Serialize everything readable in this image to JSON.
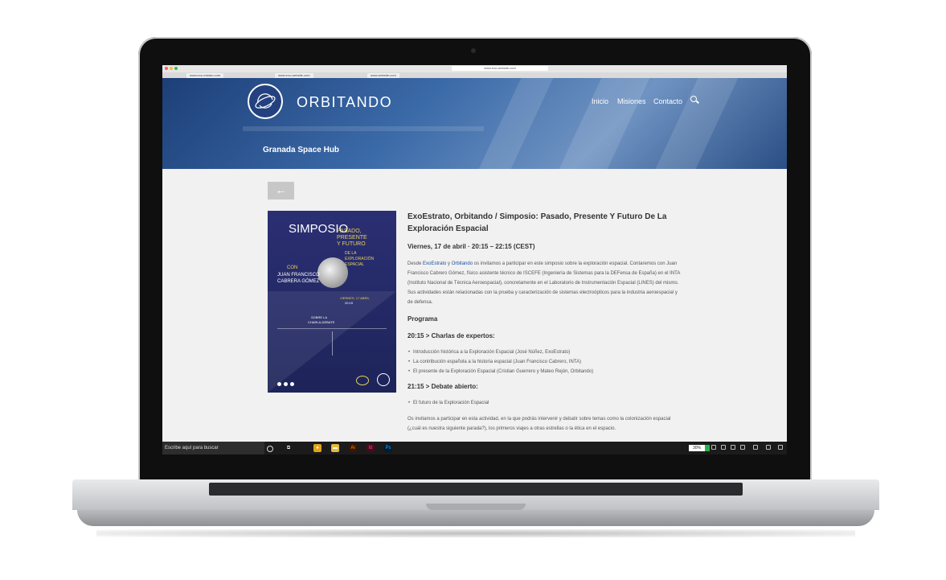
{
  "browser": {
    "tabs": [
      "www.exo-estrato.com",
      "www.exo-website.com",
      "www.website.com"
    ],
    "url": "www.exo-website.com"
  },
  "site": {
    "brand": "ORBITANDO",
    "nav": [
      "Inicio",
      "Misiones",
      "Contacto"
    ],
    "hub": "Granada Space Hub"
  },
  "poster": {
    "title": "SIMPOSIO",
    "subtitle_lines": [
      "PASADO,",
      "PRESENTE",
      "Y FUTURO",
      "DE LA",
      "EXPLORACIÓN",
      "ESPACIAL"
    ],
    "con": "CON",
    "speaker_lines": [
      "JUAN FRANCISCO",
      "CABRERA GÓMEZ"
    ],
    "date_lines": [
      "VIERNES, 17 ABRIL",
      "20:15"
    ],
    "charla_lines": [
      "SOBRE LA",
      "CHARLA-DEBATE"
    ]
  },
  "article": {
    "title": "ExoEstrato, Orbitando / Simposio: Pasado, Presente Y Futuro De La Exploración Espacial",
    "date": "Viernes, 17 de abril · 20:15 – 22:15 (CEST)",
    "intro_prefix": "Desde ",
    "intro_link1": "ExoEstrato",
    "intro_and": " y ",
    "intro_link2": "Orbitando",
    "intro_rest": " os invitamos a participar en este simposio sobre la exploración espacial. Contaremos con Juan Francisco Cabrero Gómez, físico asistente técnico de ISCEFE (Ingeniería de Sistemas para la DEFensa de España) en el INTA (Instituto Nacional de Técnica Aeroespacial), concretamente en el Laboratorio de Instrumentación Espacial (LINES) del mismo. Sus actividades están relacionadas con la prueba y caracterización de sistemas electroópticos para la industria aeroespacial y de defensa.",
    "programa": "Programa",
    "block1_title": "20:15 > Charlas de expertos:",
    "block1_items": [
      "Introducción histórica a la Exploración Espacial (José Núñez, ExoEstrato)",
      "La contribución española a la historia espacial (Juan Francisco Cabrero, INTA)",
      "El presente de la Exploración Espacial (Cristian Guerrero y Mateo Rejón, Orbitando)"
    ],
    "block2_title": "21:15 > Debate abierto:",
    "block2_items": [
      "El futuro de la Exploración Espacial"
    ],
    "outro": "Os invitamos a participar en esta actividad, en la que podrás intervenir y debatir sobre temas como la colonización espacial (¿cuál es nuestra siguiente parada?), los primeros viajes a otras estrellas o la ética en el espacio."
  },
  "taskbar": {
    "search_placeholder": "Escribe aquí para buscar",
    "battery": "30%"
  }
}
